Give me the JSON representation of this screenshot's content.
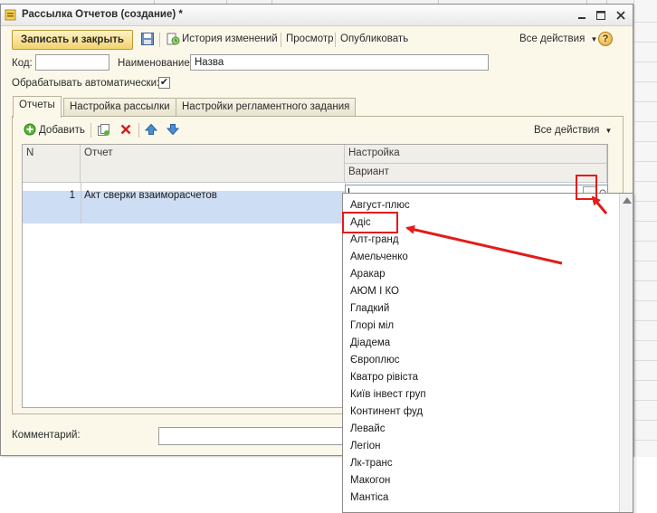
{
  "window": {
    "title": "Рассылка Отчетов (создание) *",
    "controls": {
      "minimize": "▬",
      "maximize": "☐",
      "close": "✕"
    }
  },
  "toolbar": {
    "save_close": "Записать и закрыть",
    "history": "История изменений",
    "preview": "Просмотр",
    "publish": "Опубликовать",
    "all_actions": "Все действия",
    "help": "?"
  },
  "form": {
    "code_label": "Код:",
    "code_value": "",
    "name_label": "Наименование:",
    "name_value": "Назва",
    "auto_label": "Обрабатывать автоматически:",
    "auto_checked": "✔",
    "comment_label": "Комментарий:",
    "comment_value": ""
  },
  "tabs": [
    {
      "label": "Отчеты",
      "active": true
    },
    {
      "label": "Настройка рассылки",
      "active": false
    },
    {
      "label": "Настройки регламентного задания",
      "active": false
    }
  ],
  "panel_toolbar": {
    "add": "Добавить",
    "all_actions": "Все действия"
  },
  "grid": {
    "headers": {
      "n": "N",
      "report": "Отчет",
      "setting": "Настройка",
      "variant": "Вариант"
    },
    "rows": [
      {
        "n": "1",
        "report": "Акт сверки взаиморасчетов",
        "variant": ""
      }
    ],
    "dots": "..."
  },
  "dropdown": {
    "items": [
      "Август-плюс",
      "Адіс",
      "Алт-гранд",
      "Амельченко",
      "Аракар",
      "АЮМ І КО",
      "Гладкий",
      "Глорі міл",
      "Діадема",
      "Європлюс",
      "Кватро рівіста",
      "Київ інвест груп",
      "Континент фуд",
      "Левайс",
      "Легіон",
      "Лк-транс",
      "Макогон",
      "Мантіса"
    ],
    "highlighted": "Адіс"
  },
  "colors": {
    "annotation": "#e31b1b",
    "selected_row": "#cdddf3",
    "window_bg": "#fbf8ea",
    "primary_button": "#f2d26f"
  }
}
